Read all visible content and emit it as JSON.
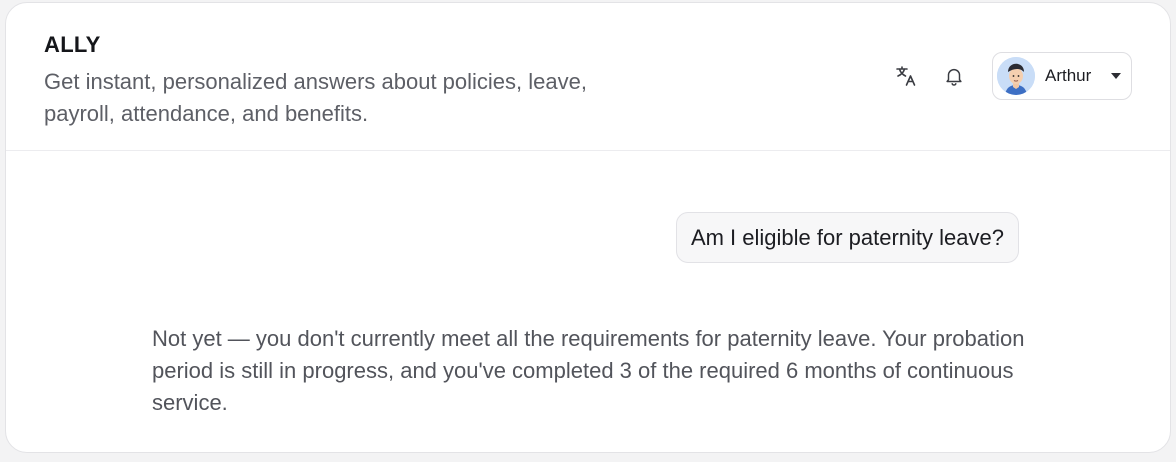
{
  "header": {
    "brand": "ALLY",
    "subtitle": "Get instant, personalized answers about policies, leave, payroll, attendance, and benefits.",
    "user": {
      "name": "Arthur"
    },
    "icons": [
      "translate-icon",
      "bell-icon",
      "chevron-down-icon"
    ]
  },
  "chat": {
    "user_message": "Am I eligible for paternity leave?",
    "assistant_message": "Not yet — you don't currently meet all the requirements for paternity leave. Your probation period is still in progress, and you've completed 3 of the required 6 months of continuous service."
  },
  "colors": {
    "text": "#1f2024",
    "muted": "#5d5f66",
    "border": "#e3e3e6",
    "bubble": "#f7f7f8"
  }
}
